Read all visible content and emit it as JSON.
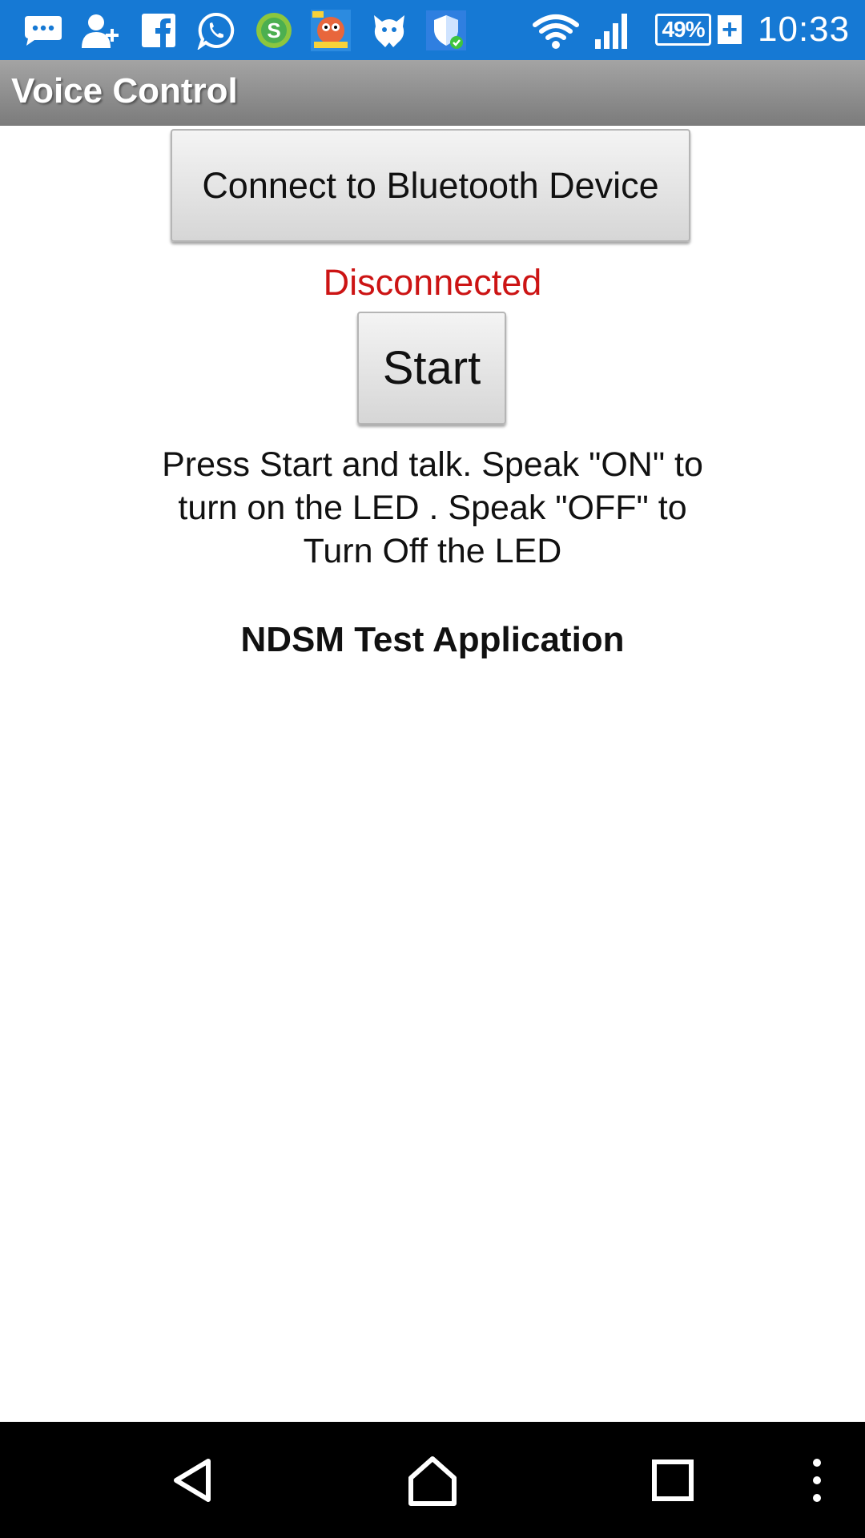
{
  "status_bar": {
    "icons": [
      "message-icon",
      "add-contact-icon",
      "facebook-icon",
      "whatsapp-icon",
      "money-app-icon",
      "game-app-icon",
      "bird-app-icon",
      "shield-icon",
      "wifi-icon",
      "signal-icon"
    ],
    "battery_percent": "49%",
    "battery_charging_symbol": "+",
    "time": "10:33",
    "background_color": "#1679d4"
  },
  "app": {
    "title": "Voice Control"
  },
  "main": {
    "connect_button_label": "Connect to Bluetooth Device",
    "connection_status": "Disconnected",
    "connection_status_color": "#cc1414",
    "start_button_label": "Start",
    "instructions": "Press Start and talk. Speak \"ON\" to turn on the LED . Speak \"OFF\" to Turn Off the LED",
    "app_name": "NDSM Test Application"
  },
  "nav_bar": {
    "buttons": [
      "back-icon",
      "home-icon",
      "recents-icon",
      "overflow-menu-icon"
    ]
  }
}
